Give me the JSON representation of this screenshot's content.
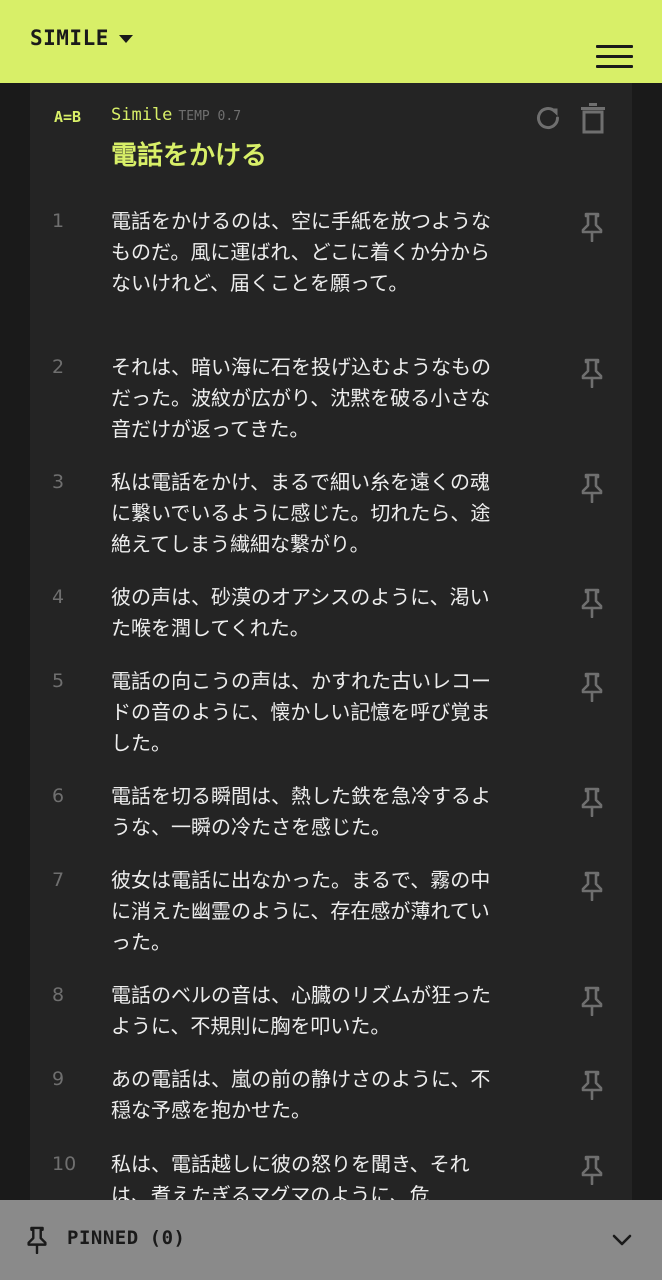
{
  "header": {
    "app_title": "SIMILE",
    "menu_icon": "hamburger-menu-icon",
    "accent_color": "#d8ef68"
  },
  "card": {
    "tag": "A=B",
    "type_name": "Simile",
    "temp_label": "TEMP 0.7",
    "title": "電話をかける",
    "refresh_icon": "refresh-icon",
    "delete_icon": "trash-icon"
  },
  "results": [
    {
      "num": "1",
      "text": "電話をかけるのは、空に手紙を放つようなものだ。風に運ばれ、どこに着くか分からないけれど、届くことを願って。"
    },
    {
      "num": "2",
      "text": "それは、暗い海に石を投げ込むようなものだった。波紋が広がり、沈黙を破る小さな音だけが返ってきた。"
    },
    {
      "num": "3",
      "text": "私は電話をかけ、まるで細い糸を遠くの魂に繋いでいるように感じた。切れたら、途絶えてしまう繊細な繋がり。"
    },
    {
      "num": "4",
      "text": "彼の声は、砂漠のオアシスのように、渇いた喉を潤してくれた。"
    },
    {
      "num": "5",
      "text": "電話の向こうの声は、かすれた古いレコードの音のように、懐かしい記憶を呼び覚ました。"
    },
    {
      "num": "6",
      "text": "電話を切る瞬間は、熱した鉄を急冷するような、一瞬の冷たさを感じた。"
    },
    {
      "num": "7",
      "text": "彼女は電話に出なかった。まるで、霧の中に消えた幽霊のように、存在感が薄れていった。"
    },
    {
      "num": "8",
      "text": "電話のベルの音は、心臓のリズムが狂ったように、不規則に胸を叩いた。"
    },
    {
      "num": "9",
      "text": "あの電話は、嵐の前の静けさのように、不穏な予感を抱かせた。"
    },
    {
      "num": "10",
      "text": "私は、電話越しに彼の怒りを聞き、それは、煮えたぎるマグマのように、危"
    }
  ],
  "footer": {
    "label": "PINNED",
    "count": "(0)",
    "pin_icon": "pin-icon",
    "chevron_icon": "chevron-down-icon"
  }
}
